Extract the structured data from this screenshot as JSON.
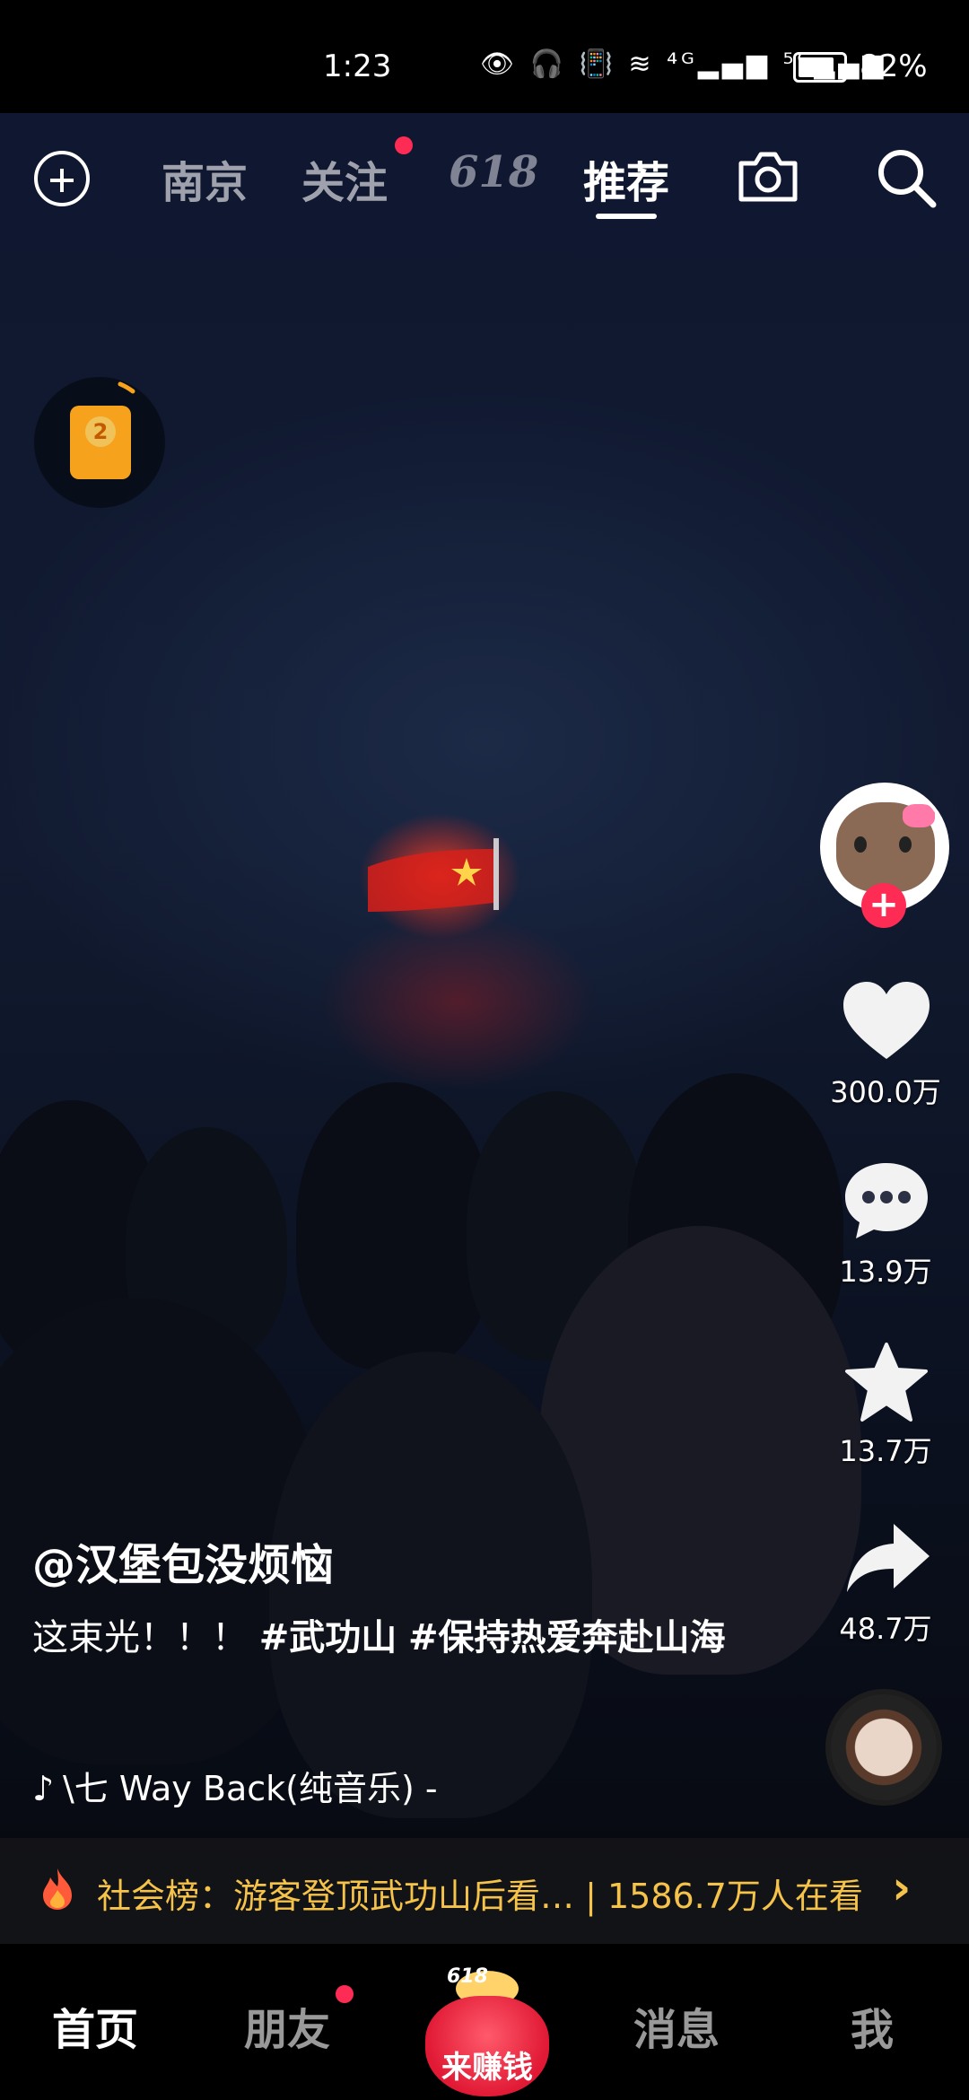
{
  "status_bar": {
    "time": "1:23",
    "indicators": "👁 🎧 📳 ≋ ⁴ᴳ▂▄▆ ⁵ᴳ▂▄▆",
    "battery_percent": "82%",
    "battery_level": 0.82
  },
  "top_nav": {
    "tabs": [
      {
        "label": "南京"
      },
      {
        "label": "关注",
        "has_dot": true
      },
      {
        "label": "618"
      },
      {
        "label": "推荐",
        "active": true
      }
    ]
  },
  "video": {
    "author": "@汉堡包没烦恼",
    "description_text": "这束光！！！ ",
    "hashtags": [
      "#武功山",
      "#保持热爱奔赴山海"
    ],
    "music": "\\七    Way Back(纯音乐) -"
  },
  "side_actions": {
    "likes": "300.0万",
    "comments": "13.9万",
    "favorites": "13.7万",
    "shares": "48.7万"
  },
  "red_packet": {
    "number": "2"
  },
  "hot_search": {
    "text": "社会榜：游客登顶武功山后看…  | 1586.7万人在看"
  },
  "bottom_nav": {
    "home": "首页",
    "friends": "朋友",
    "earn": "来赚钱",
    "earn_badge": "618",
    "messages": "消息",
    "me": "我"
  },
  "colors": {
    "accent": "#fe2c55",
    "hot_text": "#f5c24a"
  }
}
